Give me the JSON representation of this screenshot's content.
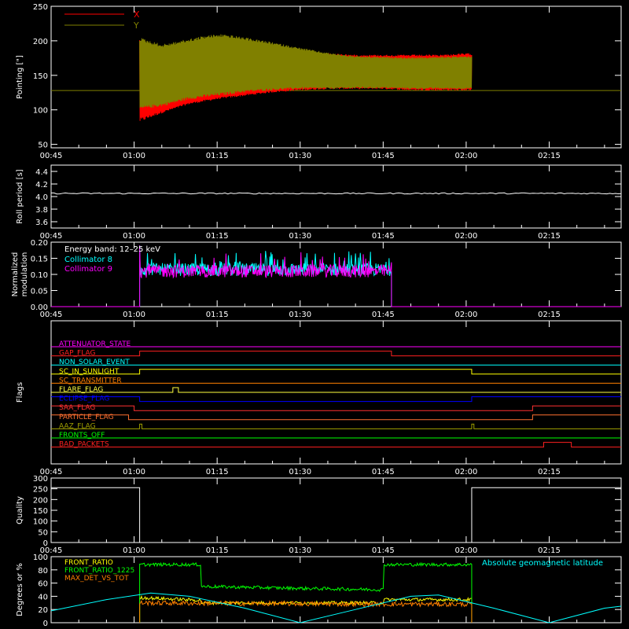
{
  "time_axis": {
    "tick_labels": [
      "00:45",
      "01:00",
      "01:15",
      "01:30",
      "01:45",
      "02:00",
      "02:15"
    ],
    "tick_minutes": [
      45,
      60,
      75,
      90,
      105,
      120,
      135
    ],
    "range_minutes": [
      45,
      148
    ]
  },
  "colors": {
    "background": "#000000",
    "axis": "#ffffff",
    "red": "#ff0000",
    "olive": "#808000",
    "cyan": "#00ffff",
    "magenta": "#ff00ff",
    "white": "#ffffff"
  },
  "chart_data": [
    {
      "id": "pointing",
      "type": "line",
      "ylabel": "Pointing [\"]",
      "ylim": [
        45,
        250
      ],
      "yticks": [
        50,
        100,
        150,
        200,
        250
      ],
      "legend": [
        {
          "name": "X",
          "color": "#ff0000"
        },
        {
          "name": "Y",
          "color": "#808000"
        }
      ],
      "baseline_value": 128,
      "active_interval_minutes": [
        61.0,
        121.0
      ],
      "series": [
        {
          "name": "X",
          "color": "#ff0000",
          "envelope_min": [
            [
              61,
              82
            ],
            [
              65,
              95
            ],
            [
              70,
              108
            ],
            [
              75,
              115
            ],
            [
              80,
              120
            ],
            [
              85,
              125
            ],
            [
              90,
              128
            ],
            [
              95,
              130
            ],
            [
              100,
              130
            ],
            [
              105,
              130
            ],
            [
              110,
              128
            ],
            [
              115,
              128
            ],
            [
              120,
              128
            ]
          ],
          "envelope_max": [
            [
              61,
              205
            ],
            [
              65,
              160
            ],
            [
              70,
              165
            ],
            [
              75,
              170
            ],
            [
              80,
              175
            ],
            [
              85,
              178
            ],
            [
              90,
              180
            ],
            [
              95,
              182
            ],
            [
              100,
              180
            ],
            [
              105,
              180
            ],
            [
              110,
              180
            ],
            [
              115,
              180
            ],
            [
              120,
              182
            ]
          ]
        },
        {
          "name": "Y",
          "color": "#808000",
          "envelope_min": [
            [
              61,
              100
            ],
            [
              65,
              105
            ],
            [
              70,
              115
            ],
            [
              75,
              120
            ],
            [
              80,
              125
            ],
            [
              85,
              128
            ],
            [
              90,
              130
            ],
            [
              95,
              130
            ],
            [
              100,
              131
            ],
            [
              105,
              131
            ],
            [
              110,
              130
            ],
            [
              115,
              130
            ],
            [
              120,
              130
            ]
          ],
          "envelope_max": [
            [
              61,
              205
            ],
            [
              65,
              195
            ],
            [
              70,
              203
            ],
            [
              73,
              208
            ],
            [
              76,
              210
            ],
            [
              80,
              205
            ],
            [
              85,
              198
            ],
            [
              90,
              190
            ],
            [
              95,
              183
            ],
            [
              100,
              178
            ],
            [
              105,
              177
            ],
            [
              110,
              176
            ],
            [
              115,
              177
            ],
            [
              120,
              178
            ]
          ]
        }
      ]
    },
    {
      "id": "roll",
      "type": "line",
      "ylabel": "Roll period [s]",
      "ylim": [
        3.5,
        4.5
      ],
      "yticks": [
        3.6,
        3.8,
        4.0,
        4.2,
        4.4
      ],
      "ytick_labels": [
        "3.6",
        "3.8",
        "4.0",
        "4.2",
        "4.4"
      ],
      "series": [
        {
          "name": "",
          "color": "#ffffff",
          "values": [
            [
              45,
              4.05
            ],
            [
              148,
              4.05
            ]
          ]
        }
      ]
    },
    {
      "id": "modulation",
      "type": "line",
      "ylabel": "Normalized modulation",
      "ylabel_lines": [
        "Normalized",
        "modulation"
      ],
      "ylim": [
        0,
        0.2
      ],
      "yticks": [
        0,
        0.05,
        0.1,
        0.15,
        0.2
      ],
      "ytick_labels": [
        "0.00",
        "0.05",
        "0.10",
        "0.15",
        "0.20"
      ],
      "annotation": "Energy band: 12–25 keV",
      "active_interval_minutes": [
        61.0,
        106.5
      ],
      "series": [
        {
          "name": "Collimator 8",
          "color": "#00ffff",
          "mean": 0.115,
          "spread": 0.02
        },
        {
          "name": "Collimator 9",
          "color": "#ff00ff",
          "mean": 0.11,
          "spread": 0.02
        }
      ]
    },
    {
      "id": "flags",
      "type": "line",
      "ylabel": "Flags",
      "flags": [
        {
          "name": "ATTENUATOR_STATE",
          "color": "#ff00ff",
          "steps": []
        },
        {
          "name": "GAP_FLAG",
          "color": "#ff2020",
          "steps": [
            [
              45,
              0
            ],
            [
              61,
              1
            ],
            [
              106.5,
              0
            ]
          ]
        },
        {
          "name": "NON_SOLAR_EVENT",
          "color": "#00ffff",
          "steps": []
        },
        {
          "name": "SC_IN_SUNLIGHT",
          "color": "#ffff00",
          "steps": [
            [
              45,
              0
            ],
            [
              61,
              1
            ],
            [
              121,
              0
            ]
          ]
        },
        {
          "name": "SC_TRANSMITTER",
          "color": "#ff7f00",
          "steps": []
        },
        {
          "name": "FLARE_FLAG",
          "color": "#ffff40",
          "steps": [
            [
              45,
              0
            ],
            [
              67,
              1
            ],
            [
              68,
              0
            ]
          ]
        },
        {
          "name": "ECLIPSE_FLAG",
          "color": "#0000ff",
          "steps": [
            [
              45,
              1
            ],
            [
              61,
              0
            ],
            [
              121,
              1
            ]
          ]
        },
        {
          "name": "SAA_FLAG",
          "color": "#ff3030",
          "steps": [
            [
              45,
              1
            ],
            [
              60,
              0
            ],
            [
              132,
              1
            ]
          ]
        },
        {
          "name": "PARTICLE_FLAG",
          "color": "#ff7030",
          "steps": [
            [
              45,
              1
            ],
            [
              59,
              0
            ],
            [
              132,
              1
            ]
          ]
        },
        {
          "name": "AAZ_FLAG",
          "color": "#a0a000",
          "steps": [
            [
              45,
              0
            ],
            [
              61,
              1
            ],
            [
              61.4,
              0
            ],
            [
              121,
              1
            ],
            [
              121.4,
              0
            ]
          ]
        },
        {
          "name": "FRONTS_OFF",
          "color": "#00ff00",
          "steps": []
        },
        {
          "name": "BAD_PACKETS",
          "color": "#ff2020",
          "steps": [
            [
              45,
              0
            ],
            [
              134,
              1
            ],
            [
              139,
              0
            ]
          ]
        }
      ]
    },
    {
      "id": "quality",
      "type": "line",
      "ylabel": "Quality",
      "ylim": [
        0,
        300
      ],
      "yticks": [
        0,
        50,
        100,
        150,
        200,
        250,
        300
      ],
      "series": [
        {
          "name": "",
          "color": "#ffffff",
          "values": [
            [
              45,
              255
            ],
            [
              61,
              255
            ],
            [
              61,
              0
            ],
            [
              121,
              0
            ],
            [
              121,
              255
            ],
            [
              148,
              255
            ]
          ]
        }
      ]
    },
    {
      "id": "geomag",
      "type": "line",
      "ylabel": "Degrees or %",
      "ylim": [
        0,
        100
      ],
      "yticks": [
        0,
        20,
        40,
        60,
        80,
        100
      ],
      "annotation": "Absolute geomagnetic latitude",
      "series": [
        {
          "name": "FRONT_RATIO",
          "color": "#ffff00",
          "values": [
            [
              61,
              0
            ],
            [
              61,
              38
            ],
            [
              72,
              34
            ],
            [
              72,
              30
            ],
            [
              105,
              30
            ],
            [
              105,
              35
            ],
            [
              121,
              35
            ],
            [
              121,
              0
            ]
          ]
        },
        {
          "name": "FRONT_RATIO_1225",
          "color": "#00ff00",
          "values": [
            [
              61,
              0
            ],
            [
              61,
              88
            ],
            [
              72,
              88
            ],
            [
              72,
              55
            ],
            [
              90,
              52
            ],
            [
              105,
              50
            ],
            [
              105,
              88
            ],
            [
              121,
              88
            ],
            [
              121,
              0
            ]
          ]
        },
        {
          "name": "MAX_DET_VS_TOT",
          "color": "#ff8000",
          "values": [
            [
              61,
              0
            ],
            [
              61,
              30
            ],
            [
              105,
              28
            ],
            [
              121,
              28
            ],
            [
              121,
              0
            ]
          ]
        },
        {
          "name": "Absolute geomagnetic latitude",
          "color": "#00ffff",
          "values": [
            [
              45,
              18
            ],
            [
              55,
              35
            ],
            [
              63,
              45
            ],
            [
              70,
              40
            ],
            [
              80,
              22
            ],
            [
              90,
              0
            ],
            [
              100,
              20
            ],
            [
              110,
              40
            ],
            [
              115,
              42
            ],
            [
              125,
              22
            ],
            [
              135,
              0
            ],
            [
              145,
              22
            ],
            [
              148,
              25
            ]
          ]
        }
      ]
    }
  ]
}
